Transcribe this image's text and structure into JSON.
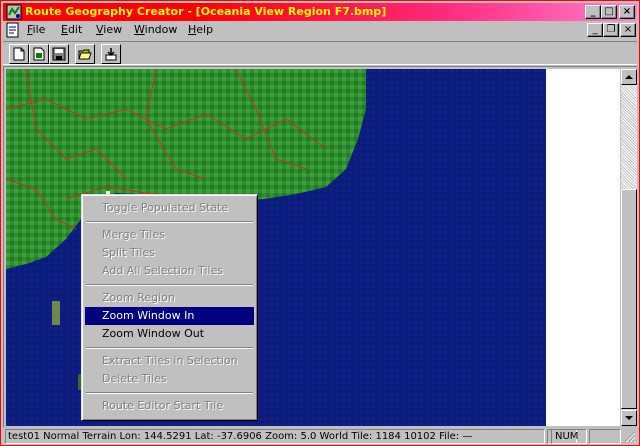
{
  "window": {
    "title": "Route Geography Creator - [Oceania View Region F7.bmp]",
    "minimize_glyph": "_",
    "maximize_glyph": "□",
    "close_glyph": "×"
  },
  "menubar": {
    "items": [
      {
        "label": "File",
        "hotkey": "F",
        "rest": "ile"
      },
      {
        "label": "Edit",
        "hotkey": "E",
        "rest": "dit"
      },
      {
        "label": "View",
        "hotkey": "V",
        "rest": "iew"
      },
      {
        "label": "Window",
        "hotkey": "W",
        "rest": "indow"
      },
      {
        "label": "Help",
        "hotkey": "H",
        "rest": "elp"
      }
    ],
    "mdi_minimize_glyph": "_",
    "mdi_restore_glyph": "❐",
    "mdi_close_glyph": "×"
  },
  "toolbar": {
    "buttons": [
      {
        "name": "new-document",
        "icon": "new-document-icon"
      },
      {
        "name": "new-view",
        "icon": "new-view-icon"
      },
      {
        "name": "save",
        "icon": "floppy-disk-icon"
      },
      {
        "name": "open",
        "icon": "open-folder-icon"
      },
      {
        "name": "import",
        "icon": "import-arrow-icon"
      }
    ]
  },
  "context_menu": {
    "items": [
      {
        "label": "Toggle Populated State",
        "enabled": false
      },
      {
        "label": "Merge Tiles",
        "enabled": false
      },
      {
        "label": "Split Tiles",
        "enabled": false
      },
      {
        "label": "Add All Selection Tiles",
        "enabled": false
      },
      {
        "label": "Zoom Region",
        "enabled": false
      },
      {
        "label": "Zoom Window In",
        "enabled": true,
        "selected": true
      },
      {
        "label": "Zoom Window Out",
        "enabled": true
      },
      {
        "label": "Extract Tiles in Selection",
        "enabled": false
      },
      {
        "label": "Delete Tiles",
        "enabled": false
      },
      {
        "label": "Route Editor Start Tile",
        "enabled": false
      }
    ]
  },
  "statusbar": {
    "text": "test01 Normal Terrain  Lon: 144.5291  Lat: -37.6906  Zoom: 5.0    World Tile: 1184 10102  File: —",
    "num": "NUM"
  },
  "colors": {
    "title_gradient_start": "#ff0000",
    "title_gradient_end": "#ff7fd0",
    "selection": "#000080",
    "ocean": "#0a1a78",
    "land": "#2e8a2e"
  }
}
